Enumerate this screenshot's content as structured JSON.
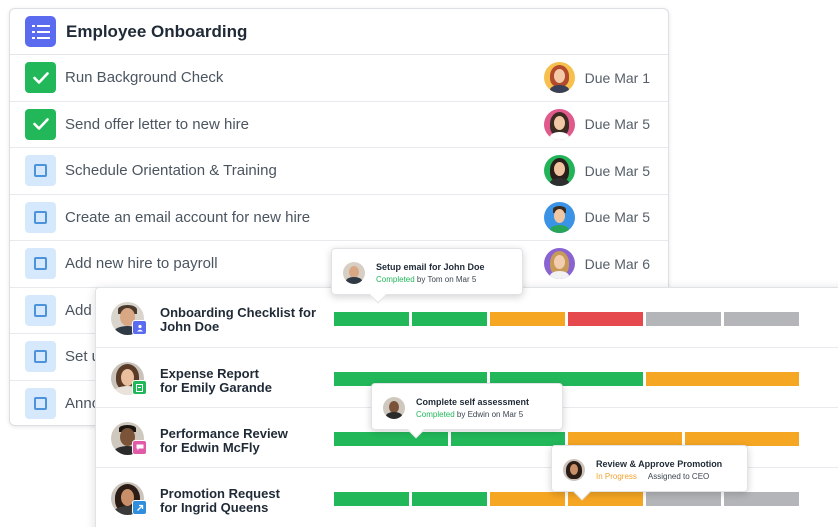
{
  "checklist": {
    "title": "Employee Onboarding",
    "tasks": [
      {
        "label": "Run Background Check",
        "done": true,
        "due": "Due Mar 1"
      },
      {
        "label": "Send offer letter to new hire",
        "done": true,
        "due": "Due Mar 5"
      },
      {
        "label": "Schedule Orientation & Training",
        "done": false,
        "due": "Due Mar 5"
      },
      {
        "label": "Create an email account for new hire",
        "done": false,
        "due": "Due Mar 5"
      },
      {
        "label": "Add new hire to payroll",
        "done": false,
        "due": "Due Mar 6"
      },
      {
        "label": "Add",
        "done": false,
        "due": ""
      },
      {
        "label": "Set u",
        "done": false,
        "due": ""
      },
      {
        "label": "Anno",
        "done": false,
        "due": ""
      }
    ]
  },
  "progress": {
    "rows": [
      {
        "title_line1": "Onboarding Checklist for",
        "title_line2": "John Doe",
        "badge_icon": "person-icon",
        "segments": [
          "green",
          "green",
          "orange",
          "red",
          "gray",
          "gray"
        ]
      },
      {
        "title_line1": "Expense Report",
        "title_line2": "for Emily Garande",
        "badge_icon": "document-icon",
        "segments": [
          "green",
          "green",
          "orange"
        ]
      },
      {
        "title_line1": "Performance Review",
        "title_line2": "for Edwin McFly",
        "badge_icon": "chat-icon",
        "segments": [
          "green",
          "green",
          "orange",
          "orange"
        ]
      },
      {
        "title_line1": "Promotion Request",
        "title_line2": "for Ingrid Queens",
        "badge_icon": "arrow-up-icon",
        "segments": [
          "green",
          "green",
          "orange",
          "orange",
          "gray",
          "gray"
        ]
      }
    ]
  },
  "tooltips": {
    "email": {
      "title": "Setup email for John Doe",
      "status": "Completed",
      "detail": " by Tom on Mar 5"
    },
    "assessment": {
      "title": "Complete self assessment",
      "status": "Completed",
      "detail": " by Edwin on Mar 5"
    },
    "promotion": {
      "title": "Review & Approve Promotion",
      "status": "In Progress",
      "detail": "Assigned to CEO"
    }
  },
  "colors": {
    "accent": "#5b6bf0",
    "green": "#22b85a",
    "orange": "#f5a623",
    "red": "#e5484d",
    "gray": "#b3b5b8",
    "checkbox_todo": "#d6e8fb"
  }
}
